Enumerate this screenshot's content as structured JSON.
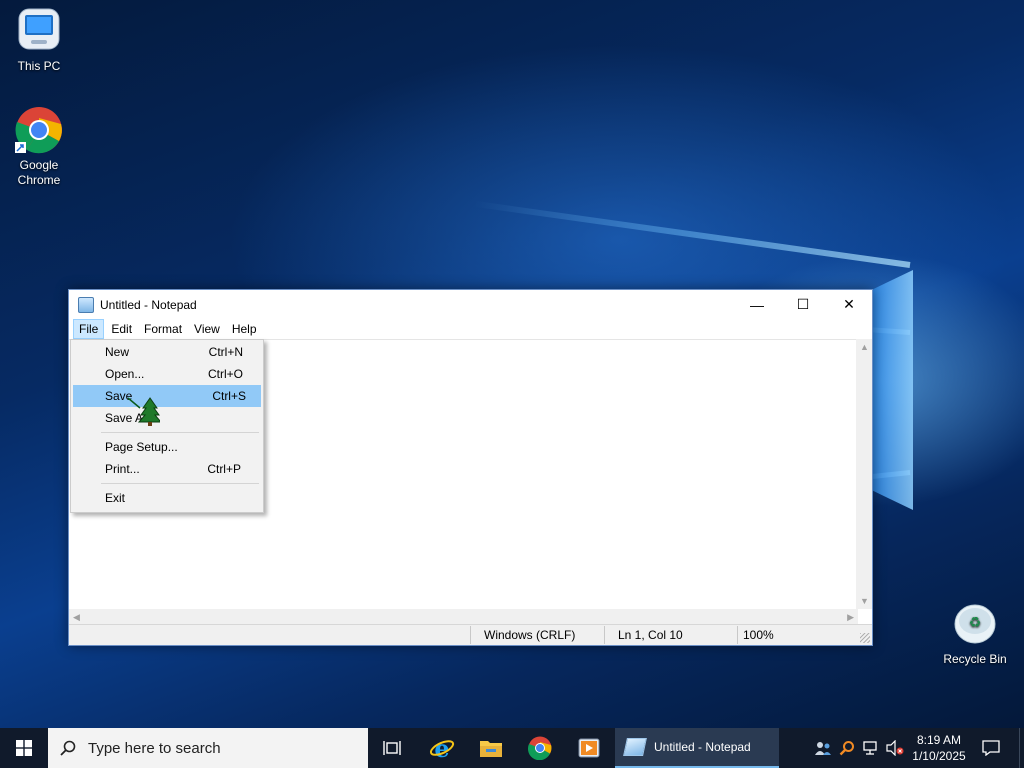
{
  "desktop": {
    "icons": [
      {
        "label": "This PC"
      },
      {
        "label": "Google Chrome"
      },
      {
        "label": "Recycle Bin"
      }
    ]
  },
  "window": {
    "title": "Untitled - Notepad",
    "controls": {
      "minimize": "—",
      "maximize": "☐",
      "close": "✕"
    },
    "menu": [
      "File",
      "Edit",
      "Format",
      "View",
      "Help"
    ],
    "file_menu": [
      {
        "label": "New",
        "shortcut": "Ctrl+N"
      },
      {
        "label": "Open...",
        "shortcut": "Ctrl+O"
      },
      {
        "label": "Save",
        "shortcut": "Ctrl+S"
      },
      {
        "label": "Save As...",
        "shortcut": ""
      },
      {
        "label": "Page Setup...",
        "shortcut": ""
      },
      {
        "label": "Print...",
        "shortcut": "Ctrl+P"
      },
      {
        "label": "Exit",
        "shortcut": ""
      }
    ],
    "statusbar": {
      "encoding": "Windows (CRLF)",
      "position": "Ln 1, Col 10",
      "zoom": "100%"
    }
  },
  "taskbar": {
    "search_placeholder": "Type here to search",
    "running_app": "Untitled - Notepad",
    "time": "8:19 AM",
    "date": "1/10/2025"
  },
  "icons": {
    "start": "windows-logo-icon",
    "search": "search-icon",
    "task_view": "task-view-icon",
    "ie": "internet-explorer-icon",
    "explorer": "file-explorer-icon",
    "chrome": "chrome-icon",
    "media": "media-player-icon",
    "notepad": "notepad-icon"
  }
}
